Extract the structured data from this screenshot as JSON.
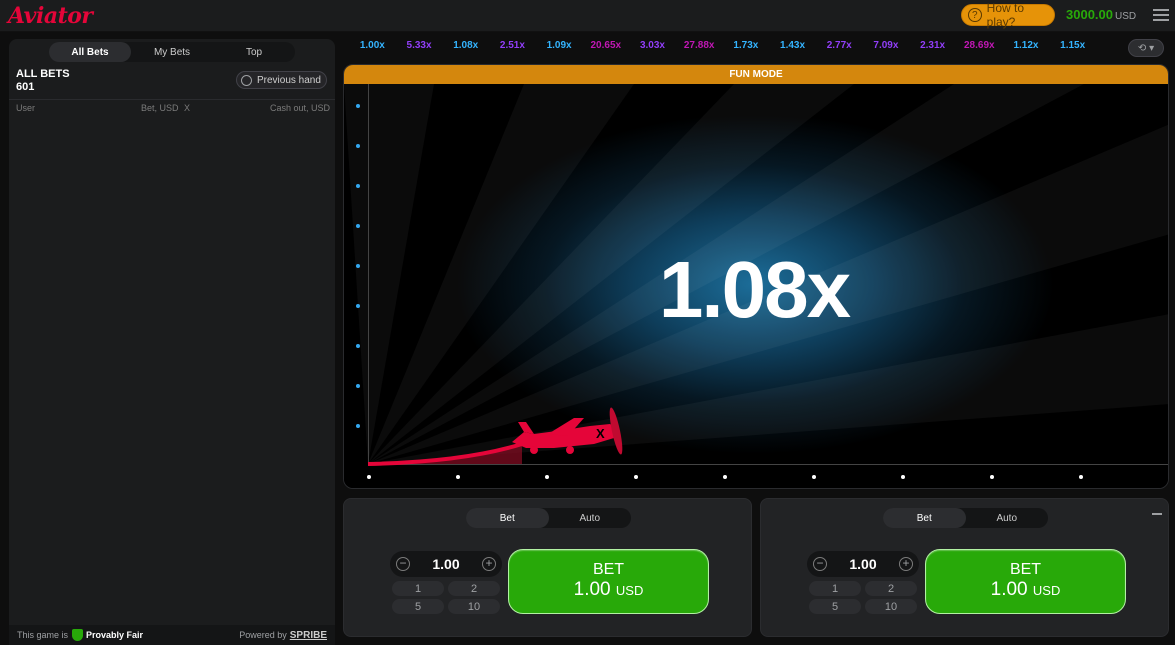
{
  "header": {
    "logo": "Aviator",
    "how_to_play": "How to play?",
    "balance": "3000.00",
    "currency": "USD"
  },
  "left_panel": {
    "tabs": [
      "All Bets",
      "My Bets",
      "Top"
    ],
    "title": "ALL BETS",
    "count": "601",
    "previous_hand": "Previous hand",
    "columns": {
      "user": "User",
      "bet": "Bet, USD",
      "x": "X",
      "cashout": "Cash out, USD"
    },
    "footer": {
      "prefix": "This game is",
      "provably": "Provably Fair",
      "powered": "Powered by",
      "brand": "SPRIBE"
    }
  },
  "history": [
    {
      "value": "1.00x",
      "color": "#34b4ff"
    },
    {
      "value": "5.33x",
      "color": "#913ef8"
    },
    {
      "value": "1.08x",
      "color": "#34b4ff"
    },
    {
      "value": "2.51x",
      "color": "#913ef8"
    },
    {
      "value": "1.09x",
      "color": "#34b4ff"
    },
    {
      "value": "20.65x",
      "color": "#c017b4"
    },
    {
      "value": "3.03x",
      "color": "#913ef8"
    },
    {
      "value": "27.88x",
      "color": "#c017b4"
    },
    {
      "value": "1.73x",
      "color": "#34b4ff"
    },
    {
      "value": "1.43x",
      "color": "#34b4ff"
    },
    {
      "value": "2.77x",
      "color": "#913ef8"
    },
    {
      "value": "7.09x",
      "color": "#913ef8"
    },
    {
      "value": "2.31x",
      "color": "#913ef8"
    },
    {
      "value": "28.69x",
      "color": "#c017b4"
    },
    {
      "value": "1.12x",
      "color": "#34b4ff"
    },
    {
      "value": "1.15x",
      "color": "#34b4ff"
    }
  ],
  "game": {
    "mode_label": "FUN MODE",
    "multiplier": "1.08x"
  },
  "bet_panels": [
    {
      "tabs": [
        "Bet",
        "Auto"
      ],
      "stake": "1.00",
      "quick": [
        "1",
        "2",
        "5",
        "10"
      ],
      "button_line1": "BET",
      "button_amount": "1.00",
      "button_currency": "USD"
    },
    {
      "tabs": [
        "Bet",
        "Auto"
      ],
      "stake": "1.00",
      "quick": [
        "1",
        "2",
        "5",
        "10"
      ],
      "button_line1": "BET",
      "button_amount": "1.00",
      "button_currency": "USD"
    }
  ]
}
